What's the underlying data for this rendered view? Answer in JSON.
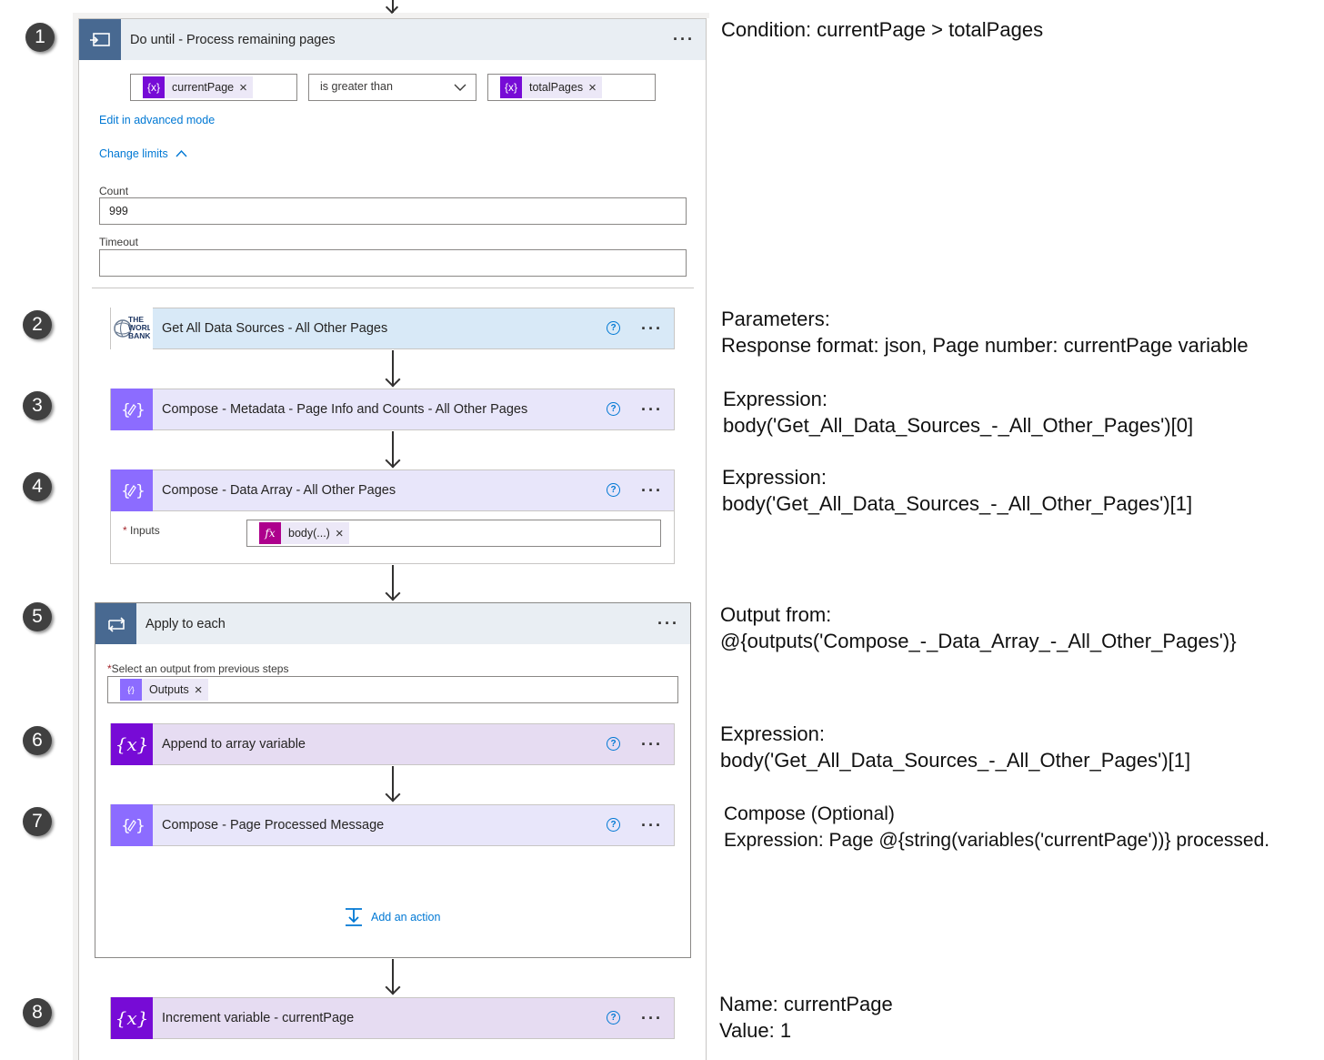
{
  "steps": [
    "1",
    "2",
    "3",
    "4",
    "5",
    "6",
    "7",
    "8"
  ],
  "do_until": {
    "title": "Do until - Process remaining pages",
    "condition": {
      "left_token": "currentPage",
      "operator": "is greater than",
      "right_token": "totalPages"
    },
    "edit_advanced_link": "Edit in advanced mode",
    "change_limits_link": "Change limits",
    "count_label": "Count",
    "count_value": "999",
    "timeout_label": "Timeout",
    "timeout_value": ""
  },
  "actions": {
    "get_sources": {
      "title": "Get All Data Sources - All Other Pages",
      "logo_text": "THE WORLD BANK"
    },
    "compose_metadata": {
      "title": "Compose - Metadata - Page Info and Counts - All Other Pages"
    },
    "compose_data_array": {
      "title": "Compose - Data Array - All Other Pages",
      "inputs_label": "Inputs",
      "inputs_token": "body(...)"
    },
    "apply_to_each": {
      "title": "Apply to each",
      "select_label": "Select an output from previous steps",
      "outputs_token": "Outputs"
    },
    "append_array": {
      "title": "Append to array variable"
    },
    "compose_page_processed": {
      "title": "Compose - Page Processed Message"
    },
    "add_action": "Add an action",
    "increment_variable": {
      "title": "Increment variable - currentPage"
    }
  },
  "notes": {
    "n1": [
      "Condition: currentPage > totalPages"
    ],
    "n2": [
      "Parameters:",
      "Response format: json, Page number: currentPage variable"
    ],
    "n3": [
      "Expression:",
      "body('Get_All_Data_Sources_-_All_Other_Pages')[0]"
    ],
    "n4": [
      "Expression:",
      "body('Get_All_Data_Sources_-_All_Other_Pages')[1]"
    ],
    "n5": [
      "Output from:",
      "@{outputs('Compose_-_Data_Array_-_All_Other_Pages')}"
    ],
    "n6": [
      "Expression:",
      "body('Get_All_Data_Sources_-_All_Other_Pages')[1]"
    ],
    "n7": [
      "Compose (Optional)",
      "Expression: Page @{string(variables('currentPage'))} processed."
    ],
    "n8": [
      "Name: currentPage",
      "Value: 1"
    ]
  },
  "colors": {
    "loop_header": "#e9eef3",
    "loop_icon": "#486991",
    "http_header": "#d8e9f7",
    "compose_header": "#e8e6fa",
    "compose_icon": "#8c6cff",
    "variable_header": "#e6dcf2",
    "variable_icon": "#770bd6",
    "expression_icon": "#ad008c",
    "link": "#0078d4"
  },
  "icons": {
    "loop": "do-until-icon",
    "apply": "loop-icon",
    "variable": "variable-icon",
    "compose": "compose-icon",
    "expression": "fx-icon",
    "help": "help-icon",
    "more": "more-icon"
  }
}
